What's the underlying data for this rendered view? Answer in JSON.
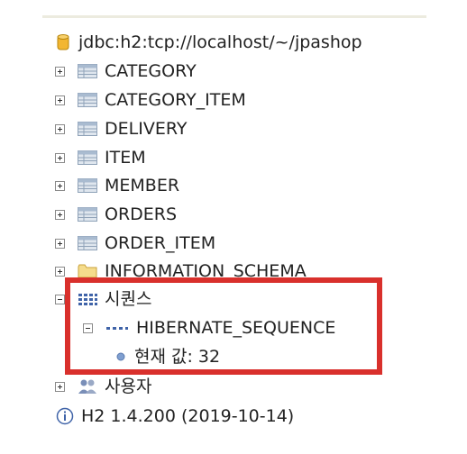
{
  "connection": {
    "label": "jdbc:h2:tcp://localhost/~/jpashop"
  },
  "tables": [
    {
      "label": "CATEGORY"
    },
    {
      "label": "CATEGORY_ITEM"
    },
    {
      "label": "DELIVERY"
    },
    {
      "label": "ITEM"
    },
    {
      "label": "MEMBER"
    },
    {
      "label": "ORDERS"
    },
    {
      "label": "ORDER_ITEM"
    }
  ],
  "schema": {
    "label": "INFORMATION_SCHEMA"
  },
  "sequences": {
    "label": "시퀀스",
    "items": [
      {
        "label": "HIBERNATE_SEQUENCE",
        "current_value": "현재 값: 32"
      }
    ]
  },
  "users": {
    "label": "사용자"
  },
  "version": {
    "label": "H2 1.4.200 (2019-10-14)"
  },
  "colors": {
    "highlight_border": "#d9302c",
    "top_border": "#ecebdf"
  }
}
